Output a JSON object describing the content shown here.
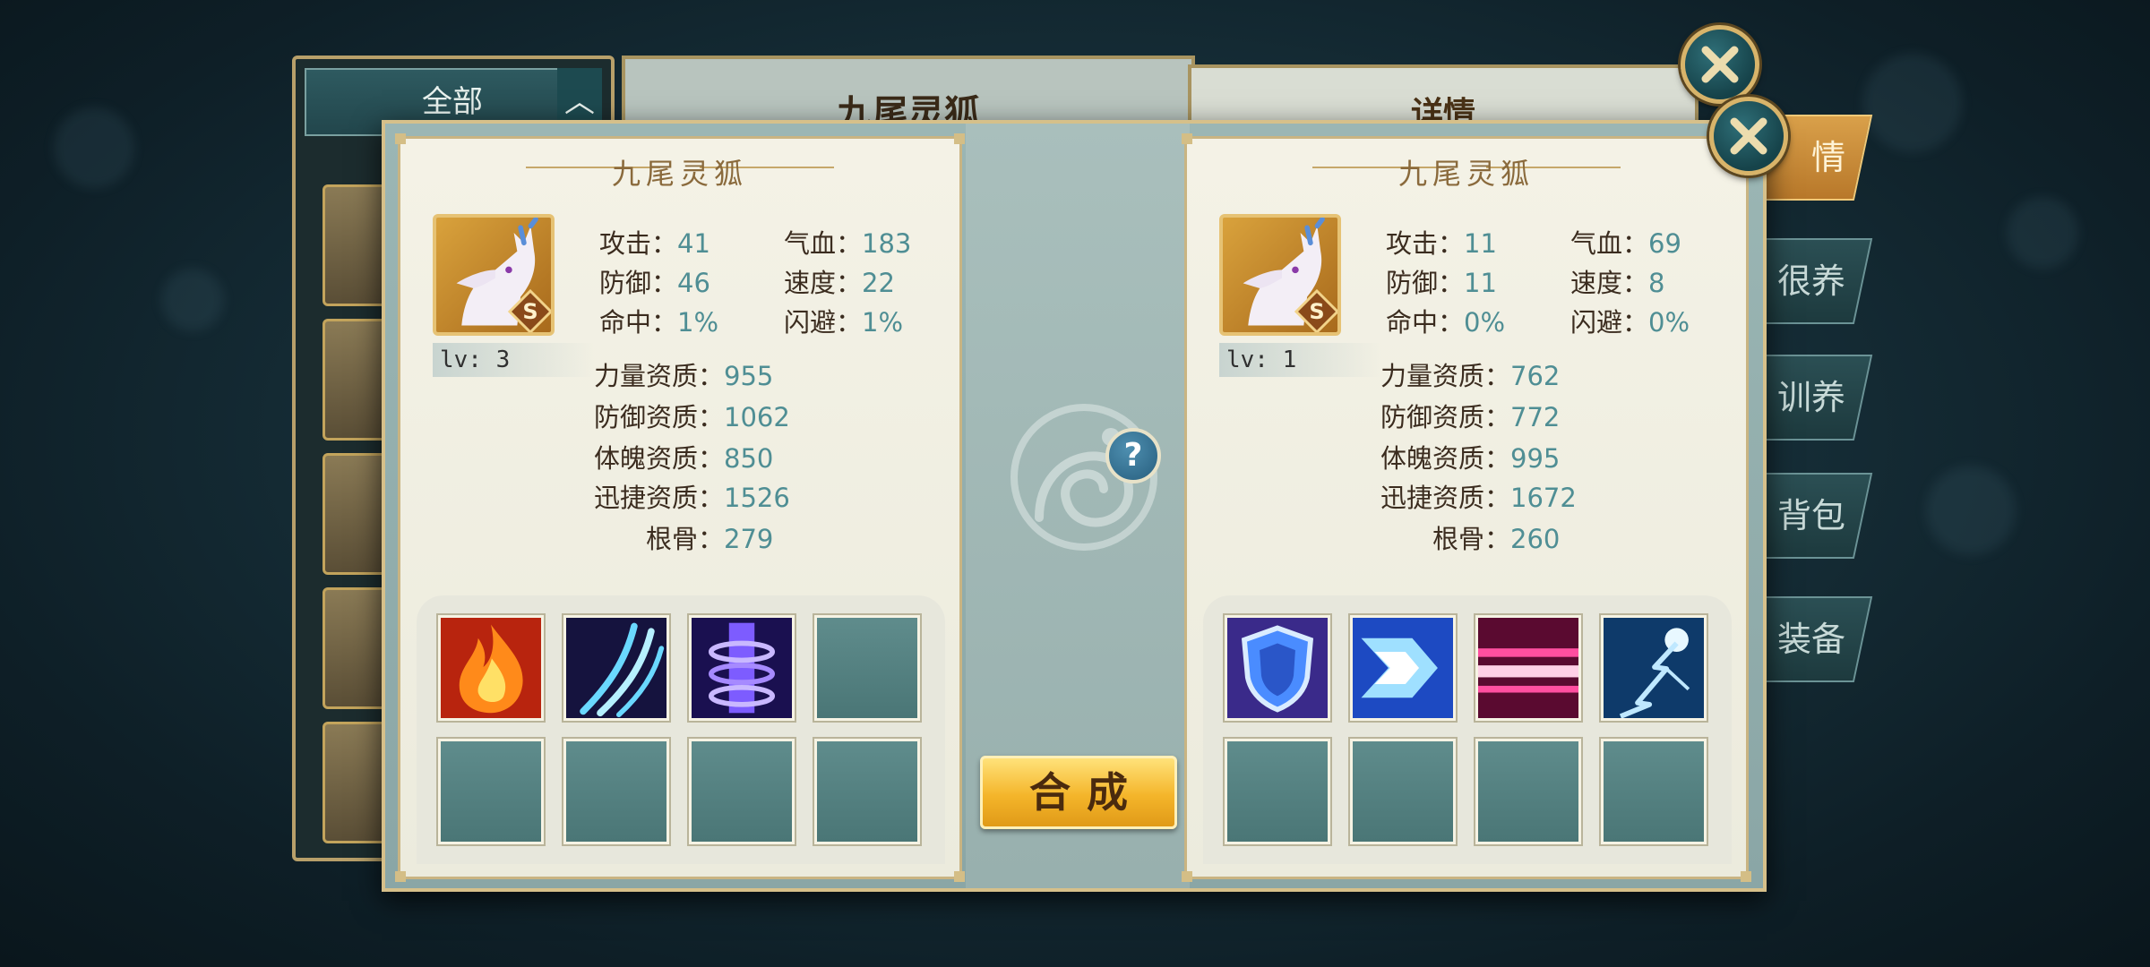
{
  "back_window": {
    "filter_tab": "全部",
    "pet_title": "九尾灵狐",
    "detail_title": "详情",
    "side_tabs": [
      "情",
      "很养",
      "训养",
      "背包",
      "装备"
    ]
  },
  "left_pet": {
    "name": "九尾灵狐",
    "grade": "S",
    "level": "lv: 3",
    "stats": {
      "attack_label": "攻击：",
      "attack": "41",
      "hp_label": "气血：",
      "hp": "183",
      "defense_label": "防御：",
      "defense": "46",
      "speed_label": "速度：",
      "speed": "22",
      "hit_label": "命中：",
      "hit": "1%",
      "dodge_label": "闪避：",
      "dodge": "1%"
    },
    "aptitudes": {
      "strength_label": "力量资质：",
      "strength": "955",
      "defense_label": "防御资质：",
      "defense": "1062",
      "physique_label": "体魄资质：",
      "physique": "850",
      "agility_label": "迅捷资质：",
      "agility": "1526",
      "root_label": "根骨：",
      "root": "279"
    },
    "skills": [
      "fire-skill-icon",
      "claw-slash-skill-icon",
      "purple-vortex-skill-icon",
      "empty-slot",
      "empty-slot",
      "empty-slot",
      "empty-slot",
      "empty-slot"
    ]
  },
  "right_pet": {
    "name": "九尾灵狐",
    "grade": "S",
    "level": "lv: 1",
    "stats": {
      "attack_label": "攻击：",
      "attack": "11",
      "hp_label": "气血：",
      "hp": "69",
      "defense_label": "防御：",
      "defense": "11",
      "speed_label": "速度：",
      "speed": "8",
      "hit_label": "命中：",
      "hit": "0%",
      "dodge_label": "闪避：",
      "dodge": "0%"
    },
    "aptitudes": {
      "strength_label": "力量资质：",
      "strength": "762",
      "defense_label": "防御资质：",
      "defense": "772",
      "physique_label": "体魄资质：",
      "physique": "995",
      "agility_label": "迅捷资质：",
      "agility": "1672",
      "root_label": "根骨：",
      "root": "260"
    },
    "skills": [
      "shield-skill-icon",
      "dash-skill-icon",
      "pink-beam-skill-icon",
      "lightning-skill-icon",
      "empty-slot",
      "empty-slot",
      "empty-slot",
      "empty-slot"
    ]
  },
  "center": {
    "help_label": "?",
    "combine_label": "合成"
  },
  "colors": {
    "stat_value": "#4f8e94",
    "stat_label": "#3b2c1f",
    "combine_button": "#f4b52a",
    "frame_gold": "#d6c08a"
  }
}
